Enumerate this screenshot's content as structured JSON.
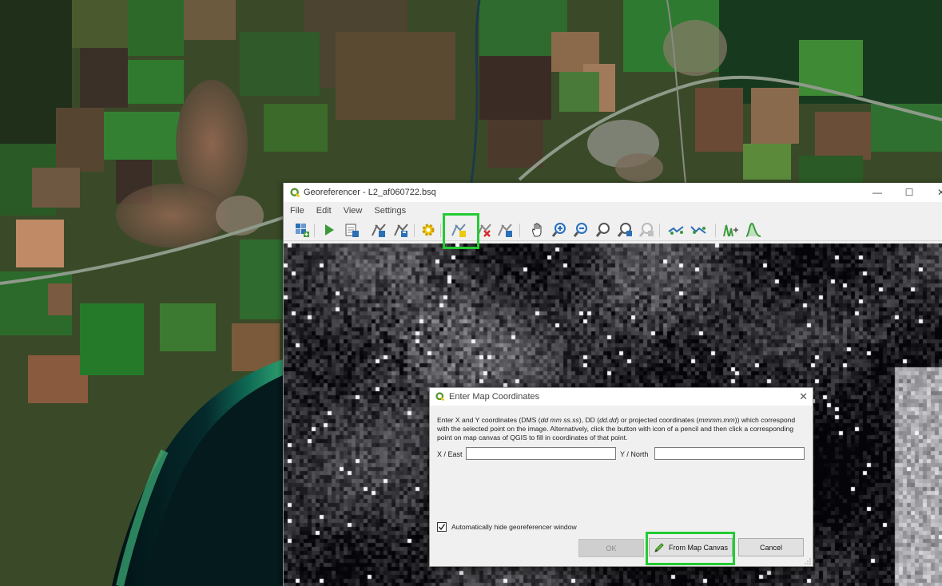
{
  "georeferencer": {
    "title": "Georeferencer - L2_af060722.bsq",
    "menu": [
      "File",
      "Edit",
      "View",
      "Settings"
    ]
  },
  "dialog": {
    "title": "Enter Map Coordinates",
    "instructions": {
      "p1": "Enter X and Y coordinates (DMS (",
      "i1": "dd mm ss.ss",
      "p2": "), DD (",
      "i2": "dd.dd",
      "p3": ") or projected coordinates (",
      "i3": "mmmm.mm",
      "p4": ")) which correspond with the selected point on the image. Alternatively, click the button with icon of a pencil and then click a corresponding point on map canvas of QGIS to fill in coordinates of that point."
    },
    "x_label": "X / East",
    "x_value": "",
    "y_label": "Y / North",
    "y_value": "",
    "checkbox_label": "Automatically hide georeferencer window",
    "checkbox_checked": true,
    "ok_label": "OK",
    "from_map_canvas_label": "From Map Canvas",
    "cancel_label": "Cancel"
  },
  "colors": {
    "highlight": "#22cc33",
    "qgis_green": "#589632",
    "qgis_yellow": "#eec90d"
  }
}
